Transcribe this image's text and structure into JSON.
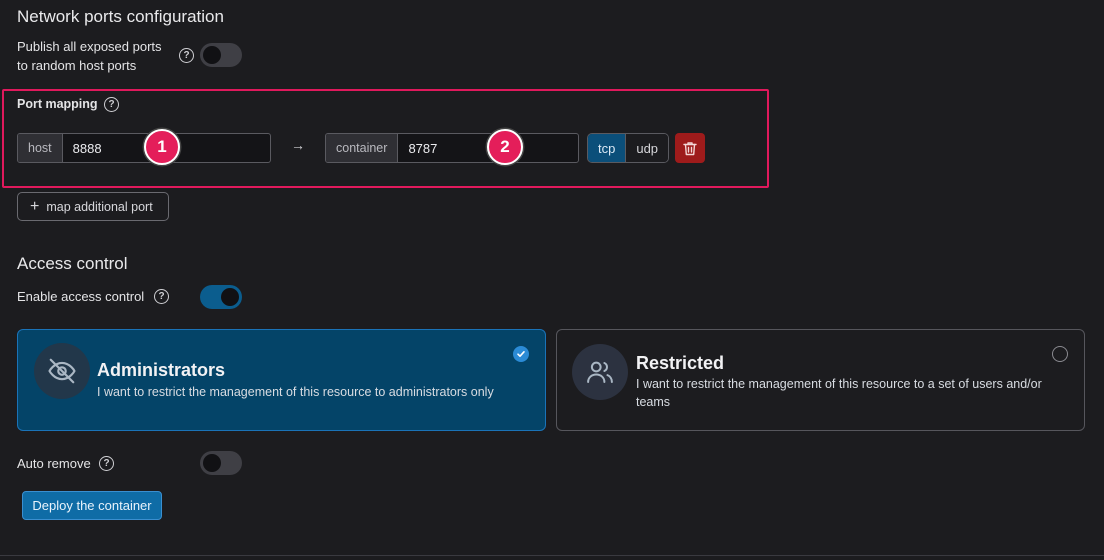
{
  "network": {
    "title": "Network ports configuration",
    "publish_label_line1": "Publish all exposed ports",
    "publish_label_line2": "to random host ports",
    "publish_enabled": false
  },
  "port_mapping": {
    "label": "Port mapping",
    "host_addon": "host",
    "host_value": "8888",
    "arrow": "→",
    "container_addon": "container",
    "container_value": "8787",
    "protocols": [
      "tcp",
      "udp"
    ],
    "selected_protocol": "tcp",
    "add_button_label": "map additional port",
    "markers": [
      "1",
      "2"
    ]
  },
  "access": {
    "title": "Access control",
    "enable_label": "Enable access control",
    "enabled": true,
    "cards": [
      {
        "title": "Administrators",
        "description": "I want to restrict the management of this resource to administrators only",
        "selected": true,
        "icon": "eye-off-icon"
      },
      {
        "title": "Restricted",
        "description": "I want to restrict the management of this resource to a set of users and/or teams",
        "selected": false,
        "icon": "users-icon"
      }
    ]
  },
  "auto_remove": {
    "label": "Auto remove",
    "enabled": false
  },
  "deploy_button_label": "Deploy the container",
  "colors": {
    "background": "#1c1c1f",
    "highlight": "#e0195c",
    "accent": "#0b5d8e",
    "danger": "#9e1b1b"
  }
}
